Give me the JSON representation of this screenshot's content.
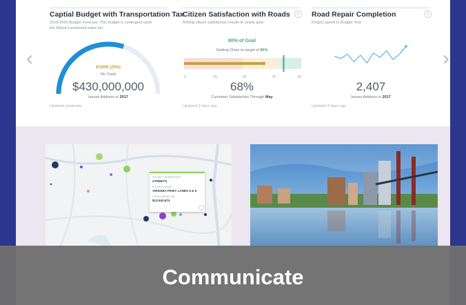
{
  "colors": {
    "background": "#2b368c",
    "accent_blue": "#1f8fd8",
    "gold": "#c8a33a",
    "teal": "#3aa8a0",
    "green": "#3db36b",
    "banner": "#707070",
    "map_pin_green": "#8cd35a"
  },
  "carousel": {
    "prev_icon": "chevron-left-icon",
    "next_icon": "chevron-right-icon",
    "prev_label": "‹",
    "next_label": "›"
  },
  "cards": [
    {
      "title": "Captial Budget with Transportation Tax",
      "subtitle": "2018-2020 Budget Forecast. This budget is contingent upon the Mayor's proposed sales tax.",
      "gauge_label": "$100M (25%)",
      "gauge_status": "On Track",
      "gauge_fraction": 0.6,
      "value": "$430,000,000",
      "caption_prefix": "Issues Address in",
      "caption_year": "2017",
      "updated": "Updated yesterday"
    },
    {
      "title": "Citizen Satisfaction with Roads",
      "subtitle": "Rolling citizen satisfaction results to yearly goal",
      "goal_label": "80% of Goal",
      "target_prefix": "Getting Close to target of",
      "target_value": "85%",
      "bar_value": 68,
      "bar_target": 85,
      "ticks": [
        "0",
        "25",
        "50",
        "75",
        "100"
      ],
      "value": "68%",
      "caption_prefix": "Customer Satisfaction Through",
      "caption_month": "May",
      "updated": "Updated 2 days ago"
    },
    {
      "title": "Road Repair Completion",
      "subtitle": "Project spend to Budget Year",
      "sparkline": [
        0.45,
        0.35,
        0.55,
        0.2,
        0.5,
        0.15,
        0.6,
        0.4,
        0.7,
        0.3,
        0.55,
        0.9
      ],
      "value": "2,407",
      "caption_prefix": "Issues Address in",
      "caption_year": "2017",
      "updated": "Updated 2 days ago"
    }
  ],
  "map_popup": {
    "dept_label": "PROJECT DEPARTMENT",
    "dept_value": "STREETS",
    "name_label": "PROJECT NAME",
    "name_value": "VIRGINIA PKWY LANES 5 & 6",
    "budget_label": "TOTAL BUDGET ($)",
    "budget_value": "$12,542,674"
  },
  "banner": {
    "text": "Communicate"
  }
}
